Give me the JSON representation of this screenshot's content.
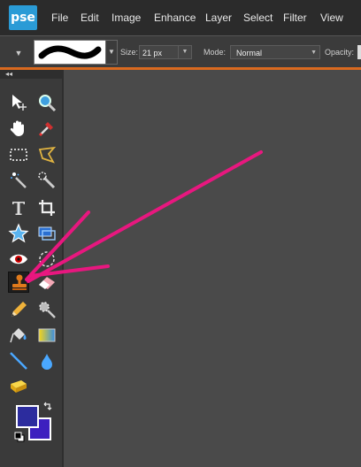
{
  "app": {
    "logo_text": "pse"
  },
  "menu": [
    {
      "label": "File"
    },
    {
      "label": "Edit"
    },
    {
      "label": "Image"
    },
    {
      "label": "Enhance"
    },
    {
      "label": "Layer"
    },
    {
      "label": "Select"
    },
    {
      "label": "Filter"
    },
    {
      "label": "View"
    }
  ],
  "options": {
    "size_label": "Size:",
    "size_value": "21 px",
    "mode_label": "Mode:",
    "mode_value": "Normal",
    "opacity_label": "Opacity:"
  },
  "toolbox": {
    "collapse_glyph": "◂◂",
    "selected_tool": "clone-stamp-icon"
  },
  "colors": {
    "foreground": "#2c2c9e",
    "background": "#3d1fbf",
    "annotation_arrows": "#e8177f",
    "accent_line": "#d9691f"
  }
}
